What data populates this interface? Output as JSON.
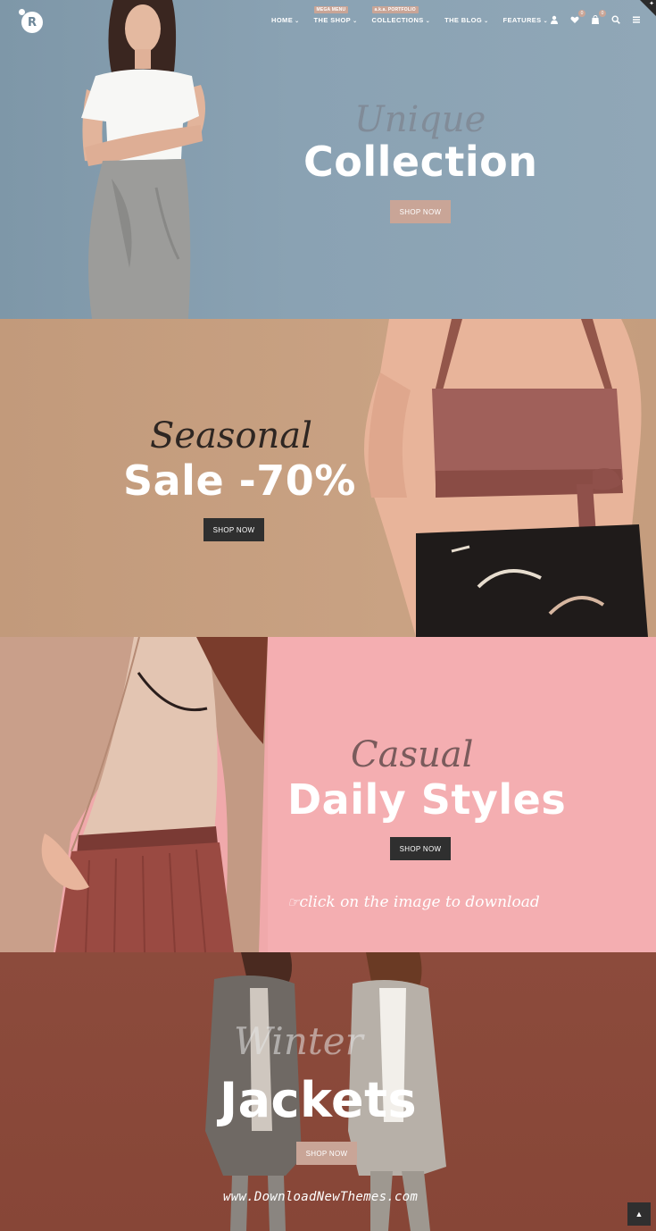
{
  "header": {
    "logo_letter": "R",
    "nav": [
      {
        "label": "HOME",
        "badge": ""
      },
      {
        "label": "THE SHOP",
        "badge": "MEGA MENU"
      },
      {
        "label": "COLLECTIONS",
        "badge": "a.k.a. PORTFOLIO"
      },
      {
        "label": "THE BLOG",
        "badge": ""
      },
      {
        "label": "FEATURES",
        "badge": ""
      }
    ],
    "wishlist_count": "0",
    "cart_count": "0"
  },
  "slides": [
    {
      "script": "Unique",
      "title": "Collection",
      "button": "SHOP NOW"
    },
    {
      "script": "Seasonal",
      "title": "Sale -70%",
      "button": "SHOP NOW"
    },
    {
      "script": "Casual",
      "title": "Daily Styles",
      "button": "SHOP NOW"
    },
    {
      "script": "Winter",
      "title": "Jackets",
      "button": "SHOP NOW"
    }
  ],
  "download_note": "click on the image to download",
  "watermark": "www.DownloadNewThemes.com",
  "colors": {
    "slide1_bg": "#8aa2b3",
    "slide2_bg": "#c9a283",
    "slide3_bg": "#f4aeb1",
    "slide4_bg": "#8a4939",
    "accent": "#c9a597",
    "dark_button": "#2f2f2f"
  }
}
